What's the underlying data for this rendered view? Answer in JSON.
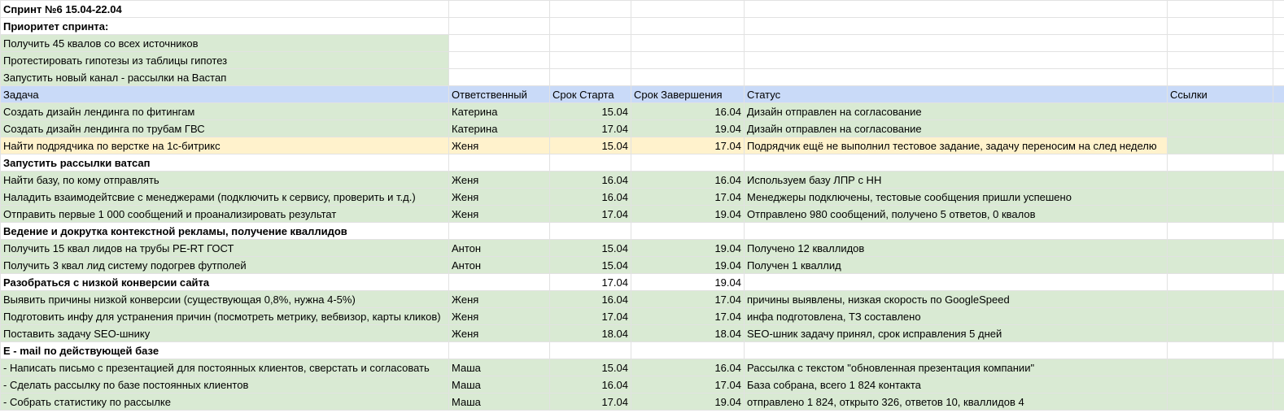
{
  "sheet": {
    "title": "Спринт №6 15.04-22.04",
    "priority_heading": "Приоритет спринта:",
    "priorities": [
      "Получить 45 квалов со всех источников",
      "Протестировать гипотезы из таблицы гипотез",
      "Запустить новый канал - рассылки на Вастап"
    ],
    "columns": [
      "Задача",
      "Ответственный",
      "Срок Старта",
      "Срок Завершения",
      "Статус",
      "Ссылки"
    ],
    "colors": {
      "done_row": "#d9ead3",
      "pending_row": "#fff2cc",
      "header_row": "#c9daf8"
    },
    "tasks": [
      {
        "task": "Создать дизайн лендинга по фитингам",
        "owner": "Катерина",
        "start": "15.04",
        "end": "16.04",
        "status": "Дизайн отправлен на согласование",
        "links": ""
      },
      {
        "task": "Создать дизайн лендинга по трубам ГВС",
        "owner": "Катерина",
        "start": "17.04",
        "end": "19.04",
        "status": "Дизайн отправлен на согласование",
        "links": ""
      },
      {
        "task": "Найти подрядчика по верстке на 1с-битрикс",
        "owner": "Женя",
        "start": "15.04",
        "end": "17.04",
        "status": "Подрядчик ещё не выполнил тестовое задание, задачу переносим на след неделю",
        "links": ""
      }
    ],
    "section1": {
      "title": "Запустить рассылки ватсап",
      "rows": [
        {
          "task": "Найти базу, по кому отправлять",
          "owner": "Женя",
          "start": "16.04",
          "end": "16.04",
          "status": "Используем базу ЛПР с НН"
        },
        {
          "task": "Наладить взаимодейтсвие с менеджерами (подключить к сервису, проверить и т.д.)",
          "owner": "Женя",
          "start": "16.04",
          "end": "17.04",
          "status": "Менеджеры подключены, тестовые сообщения пришли успешено"
        },
        {
          "task": "Отправить первые 1 000 сообщений и проанализировать результат",
          "owner": "Женя",
          "start": "17.04",
          "end": "19.04",
          "status": "Отправлено 980 сообщений, получено 5 ответов, 0 квалов"
        }
      ]
    },
    "section2": {
      "title": "Ведение и докрутка контекстной рекламы, получение кваллидов",
      "rows": [
        {
          "task": "Получить 15 квал лидов на трубы PE-RT ГОСТ",
          "owner": "Антон",
          "start": "15.04",
          "end": "19.04",
          "status": "Получено 12 кваллидов"
        },
        {
          "task": "Получить 3 квал лид систему подогрев футполей",
          "owner": "Антон",
          "start": "15.04",
          "end": "19.04",
          "status": "Получен 1 кваллид"
        }
      ]
    },
    "section3": {
      "title": "Разобраться с низкой конверсии сайта",
      "start": "17.04",
      "end": "19.04",
      "rows": [
        {
          "task": "Выявить причины низкой конверсии (существующая 0,8%, нужна 4-5%)",
          "owner": "Женя",
          "start": "16.04",
          "end": "17.04",
          "status": "причины выявлены, низкая скорость по GoogleSpeed"
        },
        {
          "task": "Подготовить инфу для устранения причин (посмотреть метрику, вебвизор, карты кликов)",
          "owner": "Женя",
          "start": "17.04",
          "end": "17.04",
          "status": "инфа подготовлена, ТЗ составлено"
        },
        {
          "task": "Поставить задачу SEO-шнику",
          "owner": "Женя",
          "start": "18.04",
          "end": "18.04",
          "status": "SEO-шник задачу принял, срок исправления 5 дней"
        }
      ]
    },
    "section4": {
      "title": "E - mail по действующей базе",
      "rows": [
        {
          "task": "- Написать письмо с презентацией для постоянных клиентов, сверстать и согласовать",
          "owner": "Маша",
          "start": "15.04",
          "end": "16.04",
          "status": "Рассылка с текстом \"обновленная презентация компании\""
        },
        {
          "task": "- Сделать рассылку по базе постоянных клиентов",
          "owner": "Маша",
          "start": "16.04",
          "end": "17.04",
          "status": "База собрана, всего 1 824 контакта"
        },
        {
          "task": "- Собрать статистику по рассылке",
          "owner": "Маша",
          "start": "17.04",
          "end": "19.04",
          "status": "отправлено 1 824, открыто 326, ответов 10, кваллидов 4"
        }
      ]
    }
  }
}
